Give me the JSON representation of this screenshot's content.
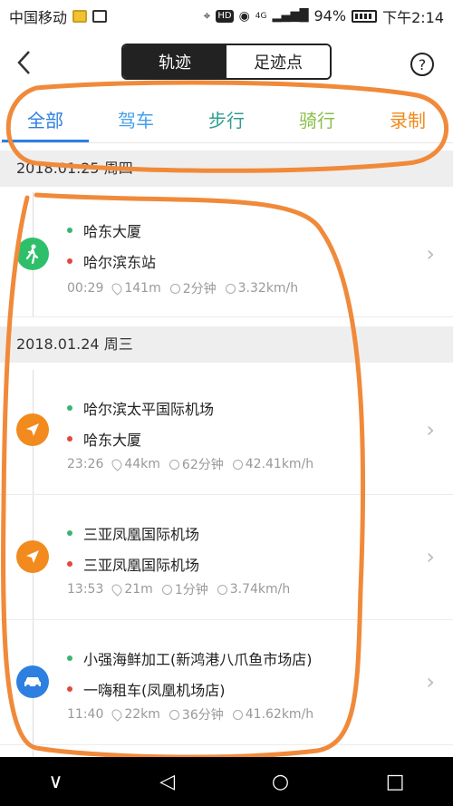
{
  "status": {
    "carrier": "中国移动",
    "battery": "94%",
    "time": "下午2:14",
    "network": "4G",
    "hd": "HD"
  },
  "header": {
    "back_icon": "back-chevron-icon",
    "seg_track": "轨迹",
    "seg_footprint": "足迹点",
    "help": "?"
  },
  "tabs": [
    "全部",
    "驾车",
    "步行",
    "骑行",
    "录制"
  ],
  "groups": [
    {
      "date": "2018.01.25 周四"
    },
    {
      "date": "2018.01.24 周三"
    }
  ],
  "trips": [
    {
      "type": "walk",
      "start": "哈东大厦",
      "end": "哈尔滨东站",
      "time": "00:29",
      "distance": "141m",
      "duration": "2分钟",
      "speed": "3.32km/h"
    },
    {
      "type": "flight",
      "start": "哈尔滨太平国际机场",
      "end": "哈东大厦",
      "time": "23:26",
      "distance": "44km",
      "duration": "62分钟",
      "speed": "42.41km/h"
    },
    {
      "type": "flight",
      "start": "三亚凤凰国际机场",
      "end": "三亚凤凰国际机场",
      "time": "13:53",
      "distance": "21m",
      "duration": "1分钟",
      "speed": "3.74km/h"
    },
    {
      "type": "car",
      "start": "小强海鲜加工(新鸿港八爪鱼市场店)",
      "end": "一嗨租车(凤凰机场店)",
      "time": "11:40",
      "distance": "22km",
      "duration": "36分钟",
      "speed": "41.62km/h"
    }
  ],
  "colors": {
    "walk": "#2fbf6b",
    "flight": "#f28a1e",
    "car": "#2d7fe0",
    "annotation": "#f08a3a"
  }
}
